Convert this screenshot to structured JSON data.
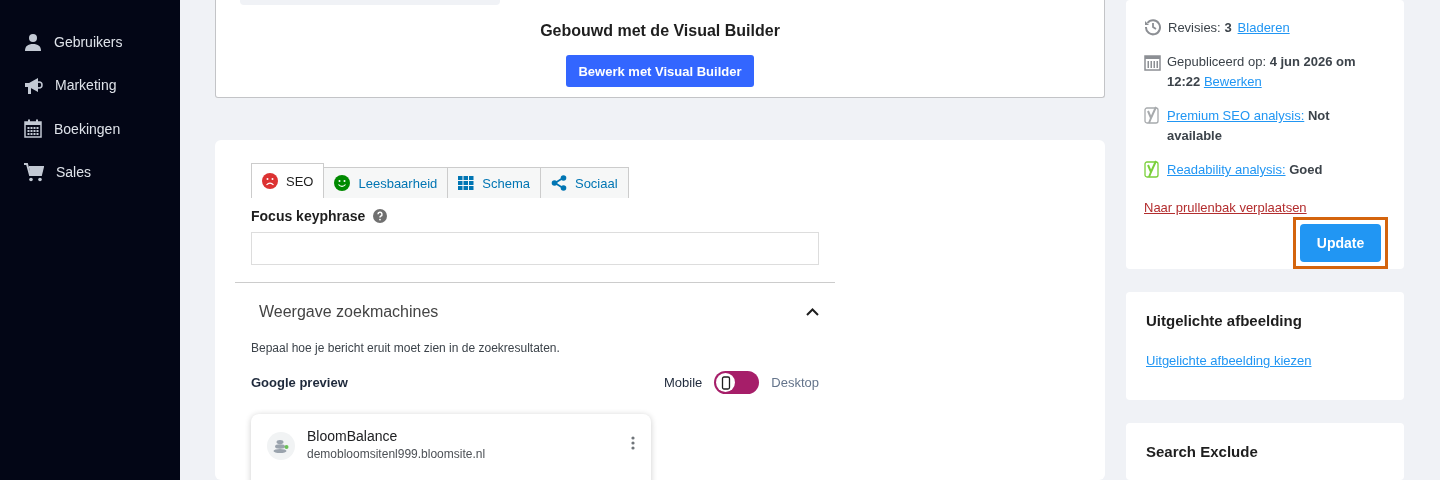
{
  "sidebar": {
    "items": [
      {
        "label": "Gebruikers",
        "kind": "user"
      },
      {
        "label": "Marketing",
        "kind": "megaphone"
      },
      {
        "label": "Boekingen",
        "kind": "calendar"
      },
      {
        "label": "Sales",
        "kind": "cart"
      }
    ]
  },
  "builder_card": {
    "heading": "Gebouwd met de Visual Builder",
    "button": "Bewerk met Visual Builder"
  },
  "seo_box": {
    "tabs": [
      {
        "label": "SEO",
        "selected": true,
        "kind": "sad",
        "color": "#dc3232"
      },
      {
        "label": "Leesbaarheid",
        "selected": false,
        "kind": "smile",
        "color": "#008a00"
      },
      {
        "label": "Schema",
        "selected": false,
        "kind": "grid",
        "color": "#0075b3"
      },
      {
        "label": "Sociaal",
        "selected": false,
        "kind": "share",
        "color": "#0075b3"
      }
    ],
    "focus_keyphrase": {
      "label": "Focus keyphrase"
    },
    "section": {
      "title": "Weergave zoekmachines",
      "expanded": true,
      "description": "Bepaal hoe je bericht eruit moet zien in de zoekresultaten.",
      "preview_label": "Google preview",
      "mode_options": [
        {
          "label": "Mobile",
          "selected": true
        },
        {
          "label": "Desktop",
          "selected": false
        }
      ],
      "preview": {
        "site_name": "BloomBalance",
        "url": "demobloomsitenl999.bloomsite.nl"
      }
    }
  },
  "publish_box": {
    "revisions": {
      "label": "Revisies:",
      "count": "3",
      "link": "Bladeren"
    },
    "published": {
      "text": "Gepubliceerd op: **4 jun 2026 om 12:22**",
      "link": "Bewerken"
    },
    "analyses": [
      {
        "link": "Premium SEO analysis:",
        "value": "Not available",
        "color": "#a7aaad"
      },
      {
        "link": "Readability analysis:",
        "value": "Goed",
        "color": "#7ad03a"
      }
    ],
    "trash_link": "Naar prullenbak verplaatsen",
    "update_button": "Update",
    "update_highlighted": true
  },
  "featured_image": {
    "title": "Uitgelichte afbeelding",
    "link": "Uitgelichte afbeelding kiezen"
  },
  "search_exclude": {
    "title": "Search Exclude"
  }
}
